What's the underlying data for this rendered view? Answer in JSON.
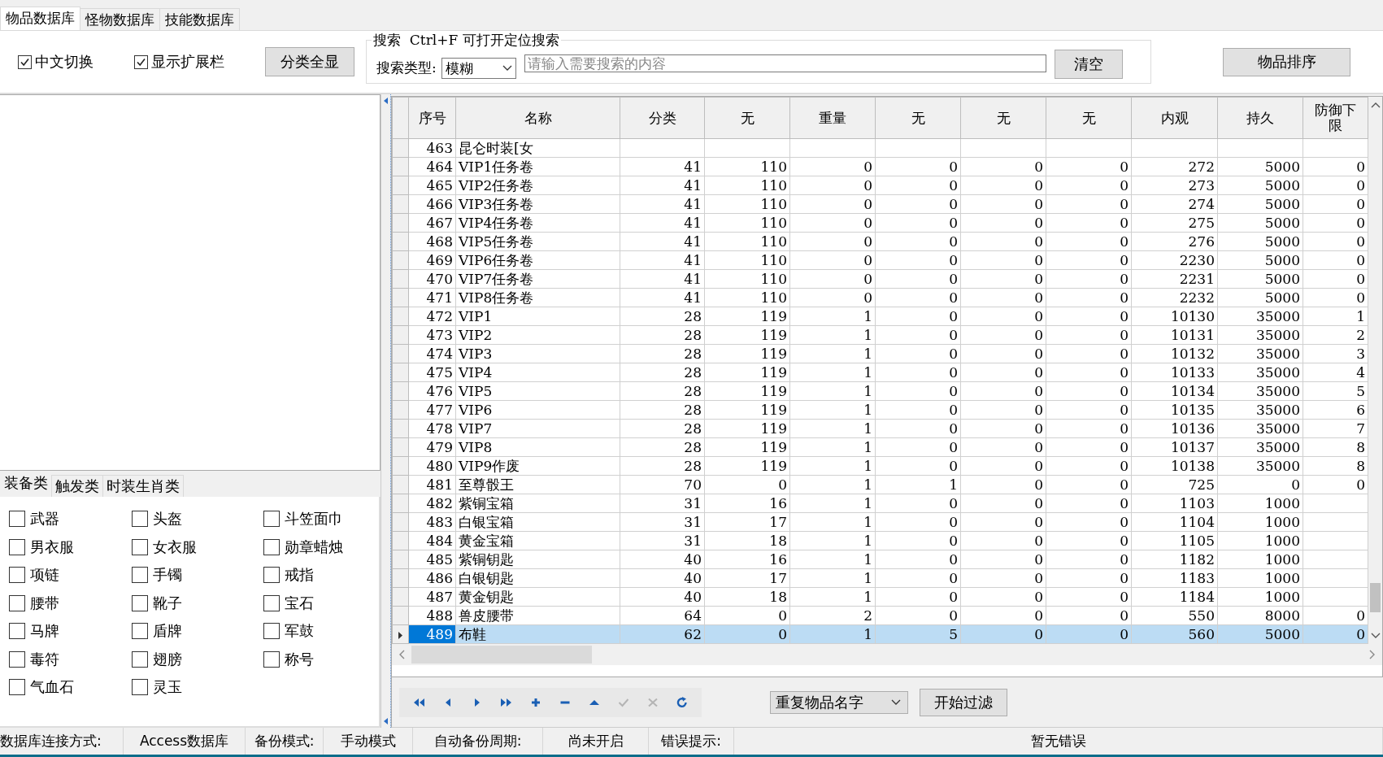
{
  "tabs": [
    {
      "label": "物品数据库",
      "selected": true
    },
    {
      "label": "怪物数据库",
      "selected": false
    },
    {
      "label": "技能数据库",
      "selected": false
    }
  ],
  "toolbar": {
    "checkboxes": [
      {
        "label": "中文切换",
        "checked": true
      },
      {
        "label": "显示扩展栏",
        "checked": true
      }
    ],
    "show_all_button": "分类全显",
    "sort_button": "物品排序"
  },
  "search": {
    "legend": "搜索  Ctrl+F 可打开定位搜索",
    "type_label": "搜索类型:",
    "type_value": "模糊",
    "placeholder": "请输入需要搜索的内容",
    "clear_button": "清空"
  },
  "category_tabs": [
    {
      "label": "装备类",
      "selected": true
    },
    {
      "label": "触发类",
      "selected": false
    },
    {
      "label": "时装生肖类",
      "selected": false
    }
  ],
  "categories": [
    {
      "label": "武器",
      "checked": false
    },
    {
      "label": "头盔",
      "checked": false
    },
    {
      "label": "斗笠面巾",
      "checked": false
    },
    {
      "label": "男衣服",
      "checked": false
    },
    {
      "label": "女衣服",
      "checked": false
    },
    {
      "label": "勋章蜡烛",
      "checked": false
    },
    {
      "label": "项链",
      "checked": false
    },
    {
      "label": "手镯",
      "checked": false
    },
    {
      "label": "戒指",
      "checked": false
    },
    {
      "label": "腰带",
      "checked": false
    },
    {
      "label": "靴子",
      "checked": false
    },
    {
      "label": "宝石",
      "checked": false
    },
    {
      "label": "马牌",
      "checked": false
    },
    {
      "label": "盾牌",
      "checked": false
    },
    {
      "label": "军鼓",
      "checked": false
    },
    {
      "label": "毒符",
      "checked": false
    },
    {
      "label": "翅膀",
      "checked": false
    },
    {
      "label": "称号",
      "checked": false
    },
    {
      "label": "气血石",
      "checked": false
    },
    {
      "label": "灵玉",
      "checked": false
    }
  ],
  "table": {
    "columns": [
      "序号",
      "名称",
      "分类",
      "无",
      "重量",
      "无",
      "无",
      "无",
      "内观",
      "持久",
      "防御下限"
    ],
    "rows": [
      {
        "cells": [
          "463",
          "昆仑时装[女"
        ],
        "selected": false
      },
      {
        "cells": [
          "464",
          "VIP1任务卷",
          "41",
          "110",
          "0",
          "0",
          "0",
          "0",
          "272",
          "5000",
          "0"
        ],
        "selected": false
      },
      {
        "cells": [
          "465",
          "VIP2任务卷",
          "41",
          "110",
          "0",
          "0",
          "0",
          "0",
          "273",
          "5000",
          "0"
        ],
        "selected": false
      },
      {
        "cells": [
          "466",
          "VIP3任务卷",
          "41",
          "110",
          "0",
          "0",
          "0",
          "0",
          "274",
          "5000",
          "0"
        ],
        "selected": false
      },
      {
        "cells": [
          "467",
          "VIP4任务卷",
          "41",
          "110",
          "0",
          "0",
          "0",
          "0",
          "275",
          "5000",
          "0"
        ],
        "selected": false
      },
      {
        "cells": [
          "468",
          "VIP5任务卷",
          "41",
          "110",
          "0",
          "0",
          "0",
          "0",
          "276",
          "5000",
          "0"
        ],
        "selected": false
      },
      {
        "cells": [
          "469",
          "VIP6任务卷",
          "41",
          "110",
          "0",
          "0",
          "0",
          "0",
          "2230",
          "5000",
          "0"
        ],
        "selected": false
      },
      {
        "cells": [
          "470",
          "VIP7任务卷",
          "41",
          "110",
          "0",
          "0",
          "0",
          "0",
          "2231",
          "5000",
          "0"
        ],
        "selected": false
      },
      {
        "cells": [
          "471",
          "VIP8任务卷",
          "41",
          "110",
          "0",
          "0",
          "0",
          "0",
          "2232",
          "5000",
          "0"
        ],
        "selected": false
      },
      {
        "cells": [
          "472",
          "VIP1",
          "28",
          "119",
          "1",
          "0",
          "0",
          "0",
          "10130",
          "35000",
          "1"
        ],
        "selected": false
      },
      {
        "cells": [
          "473",
          "VIP2",
          "28",
          "119",
          "1",
          "0",
          "0",
          "0",
          "10131",
          "35000",
          "2"
        ],
        "selected": false
      },
      {
        "cells": [
          "474",
          "VIP3",
          "28",
          "119",
          "1",
          "0",
          "0",
          "0",
          "10132",
          "35000",
          "3"
        ],
        "selected": false
      },
      {
        "cells": [
          "475",
          "VIP4",
          "28",
          "119",
          "1",
          "0",
          "0",
          "0",
          "10133",
          "35000",
          "4"
        ],
        "selected": false
      },
      {
        "cells": [
          "476",
          "VIP5",
          "28",
          "119",
          "1",
          "0",
          "0",
          "0",
          "10134",
          "35000",
          "5"
        ],
        "selected": false
      },
      {
        "cells": [
          "477",
          "VIP6",
          "28",
          "119",
          "1",
          "0",
          "0",
          "0",
          "10135",
          "35000",
          "6"
        ],
        "selected": false
      },
      {
        "cells": [
          "478",
          "VIP7",
          "28",
          "119",
          "1",
          "0",
          "0",
          "0",
          "10136",
          "35000",
          "7"
        ],
        "selected": false
      },
      {
        "cells": [
          "479",
          "VIP8",
          "28",
          "119",
          "1",
          "0",
          "0",
          "0",
          "10137",
          "35000",
          "8"
        ],
        "selected": false
      },
      {
        "cells": [
          "480",
          "VIP9作废",
          "28",
          "119",
          "1",
          "0",
          "0",
          "0",
          "10138",
          "35000",
          "8"
        ],
        "selected": false
      },
      {
        "cells": [
          "481",
          "至尊骰王",
          "70",
          "0",
          "1",
          "1",
          "0",
          "0",
          "725",
          "0",
          "0"
        ],
        "selected": false
      },
      {
        "cells": [
          "482",
          "紫铜宝箱",
          "31",
          "16",
          "1",
          "0",
          "0",
          "0",
          "1103",
          "1000"
        ],
        "selected": false
      },
      {
        "cells": [
          "483",
          "白银宝箱",
          "31",
          "17",
          "1",
          "0",
          "0",
          "0",
          "1104",
          "1000"
        ],
        "selected": false
      },
      {
        "cells": [
          "484",
          "黄金宝箱",
          "31",
          "18",
          "1",
          "0",
          "0",
          "0",
          "1105",
          "1000"
        ],
        "selected": false
      },
      {
        "cells": [
          "485",
          "紫铜钥匙",
          "40",
          "16",
          "1",
          "0",
          "0",
          "0",
          "1182",
          "1000"
        ],
        "selected": false
      },
      {
        "cells": [
          "486",
          "白银钥匙",
          "40",
          "17",
          "1",
          "0",
          "0",
          "0",
          "1183",
          "1000"
        ],
        "selected": false
      },
      {
        "cells": [
          "487",
          "黄金钥匙",
          "40",
          "18",
          "1",
          "0",
          "0",
          "0",
          "1184",
          "1000"
        ],
        "selected": false
      },
      {
        "cells": [
          "488",
          "兽皮腰带",
          "64",
          "0",
          "2",
          "0",
          "0",
          "0",
          "550",
          "8000",
          "0"
        ],
        "selected": false
      },
      {
        "cells": [
          "489",
          "布鞋",
          "62",
          "0",
          "1",
          "5",
          "0",
          "0",
          "560",
          "5000",
          "0"
        ],
        "selected": true
      }
    ]
  },
  "navigator": [
    {
      "kind": "first",
      "disabled": false
    },
    {
      "kind": "prior",
      "disabled": false
    },
    {
      "kind": "next",
      "disabled": false
    },
    {
      "kind": "last",
      "disabled": false
    },
    {
      "kind": "insert",
      "disabled": false
    },
    {
      "kind": "delete",
      "disabled": false
    },
    {
      "kind": "edit",
      "disabled": false
    },
    {
      "kind": "post",
      "disabled": true
    },
    {
      "kind": "cancel",
      "disabled": true
    },
    {
      "kind": "refresh",
      "disabled": false
    }
  ],
  "filter": {
    "value": "重复物品名字",
    "button": "开始过滤"
  },
  "status_bar": [
    "数据库连接方式:",
    "Access数据库",
    "备份模式:",
    "手动模式",
    "自动备份周期:",
    "尚未开启",
    "错误提示:",
    "暂无错误"
  ]
}
